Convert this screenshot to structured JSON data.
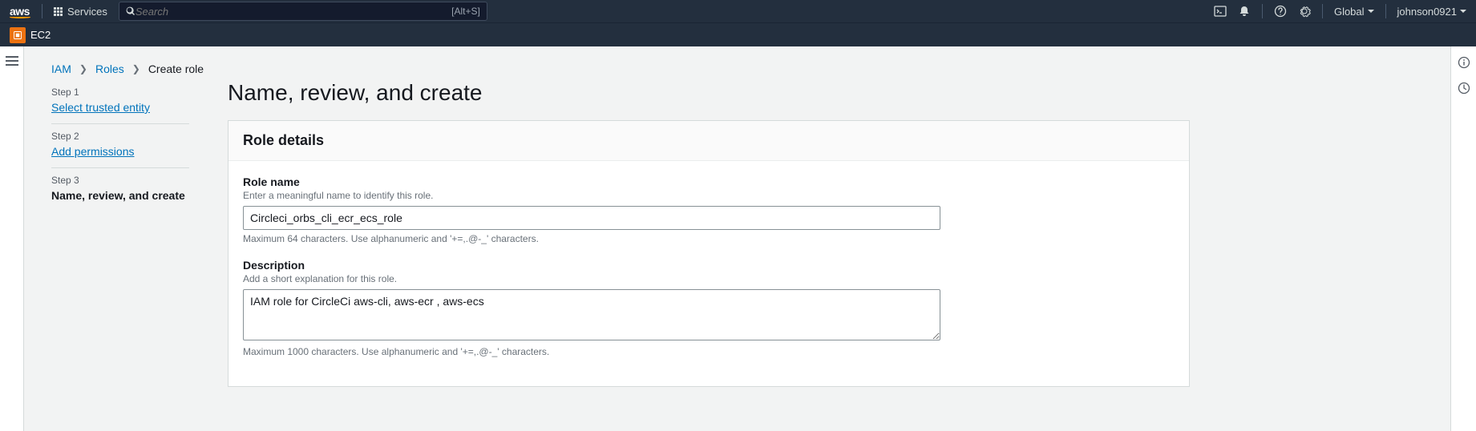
{
  "header": {
    "logo_text": "aws",
    "services_label": "Services",
    "search_placeholder": "Search",
    "search_shortcut": "[Alt+S]",
    "region_label": "Global",
    "username": "johnson0921"
  },
  "service_tab": {
    "name": "EC2"
  },
  "breadcrumb": {
    "items": [
      "IAM",
      "Roles",
      "Create role"
    ]
  },
  "steps": [
    {
      "label": "Step 1",
      "title": "Select trusted entity",
      "link": true
    },
    {
      "label": "Step 2",
      "title": "Add permissions",
      "link": true
    },
    {
      "label": "Step 3",
      "title": "Name, review, and create",
      "link": false
    }
  ],
  "page": {
    "title": "Name, review, and create"
  },
  "panel": {
    "heading": "Role details",
    "role_name": {
      "label": "Role name",
      "sub": "Enter a meaningful name to identify this role.",
      "value": "Circleci_orbs_cli_ecr_ecs_role",
      "hint": "Maximum 64 characters. Use alphanumeric and '+=,.@-_' characters."
    },
    "description": {
      "label": "Description",
      "sub": "Add a short explanation for this role.",
      "value": "IAM role for CircleCi aws-cli, aws-ecr , aws-ecs",
      "hint": "Maximum 1000 characters. Use alphanumeric and '+=,.@-_' characters."
    }
  }
}
